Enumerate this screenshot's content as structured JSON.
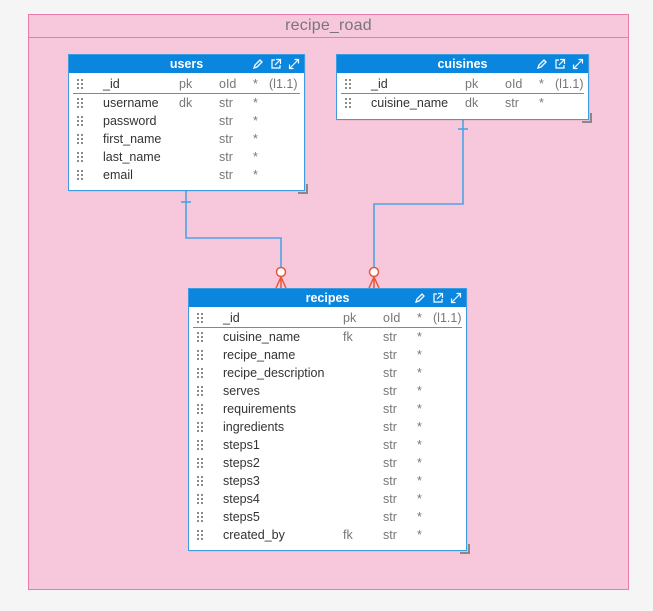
{
  "container": {
    "title": "recipe_road"
  },
  "tables": {
    "users": {
      "name": "users",
      "rows": [
        {
          "name": "_id",
          "key": "pk",
          "type": "oId",
          "star": "*",
          "card": "(l1.1)"
        },
        {
          "name": "username",
          "key": "dk",
          "type": "str",
          "star": "*",
          "card": ""
        },
        {
          "name": "password",
          "key": "",
          "type": "str",
          "star": "*",
          "card": ""
        },
        {
          "name": "first_name",
          "key": "",
          "type": "str",
          "star": "*",
          "card": ""
        },
        {
          "name": "last_name",
          "key": "",
          "type": "str",
          "star": "*",
          "card": ""
        },
        {
          "name": "email",
          "key": "",
          "type": "str",
          "star": "*",
          "card": ""
        }
      ]
    },
    "cuisines": {
      "name": "cuisines",
      "rows": [
        {
          "name": "_id",
          "key": "pk",
          "type": "oId",
          "star": "*",
          "card": "(l1.1)"
        },
        {
          "name": "cuisine_name",
          "key": "dk",
          "type": "str",
          "star": "*",
          "card": ""
        }
      ]
    },
    "recipes": {
      "name": "recipes",
      "rows": [
        {
          "name": "_id",
          "key": "pk",
          "type": "oId",
          "star": "*",
          "card": "(l1.1)"
        },
        {
          "name": "cuisine_name",
          "key": "fk",
          "type": "str",
          "star": "*",
          "card": ""
        },
        {
          "name": "recipe_name",
          "key": "",
          "type": "str",
          "star": "*",
          "card": ""
        },
        {
          "name": "recipe_description",
          "key": "",
          "type": "str",
          "star": "*",
          "card": ""
        },
        {
          "name": "serves",
          "key": "",
          "type": "str",
          "star": "*",
          "card": ""
        },
        {
          "name": "requirements",
          "key": "",
          "type": "str",
          "star": "*",
          "card": ""
        },
        {
          "name": "ingredients",
          "key": "",
          "type": "str",
          "star": "*",
          "card": ""
        },
        {
          "name": "steps1",
          "key": "",
          "type": "str",
          "star": "*",
          "card": ""
        },
        {
          "name": "steps2",
          "key": "",
          "type": "str",
          "star": "*",
          "card": ""
        },
        {
          "name": "steps3",
          "key": "",
          "type": "str",
          "star": "*",
          "card": ""
        },
        {
          "name": "steps4",
          "key": "",
          "type": "str",
          "star": "*",
          "card": ""
        },
        {
          "name": "steps5",
          "key": "",
          "type": "str",
          "star": "*",
          "card": ""
        },
        {
          "name": "created_by",
          "key": "fk",
          "type": "str",
          "star": "*",
          "card": ""
        }
      ]
    }
  },
  "icons": [
    "edit-icon",
    "open-external-icon",
    "expand-icon",
    "drag-handle-icon",
    "resize-handle-icon"
  ],
  "colors": {
    "header": "#0a86de",
    "line": "#4fa3e3",
    "crowfoot": "#e8553a",
    "container_bg": "#f7c7dc",
    "container_border": "#e97bab"
  }
}
